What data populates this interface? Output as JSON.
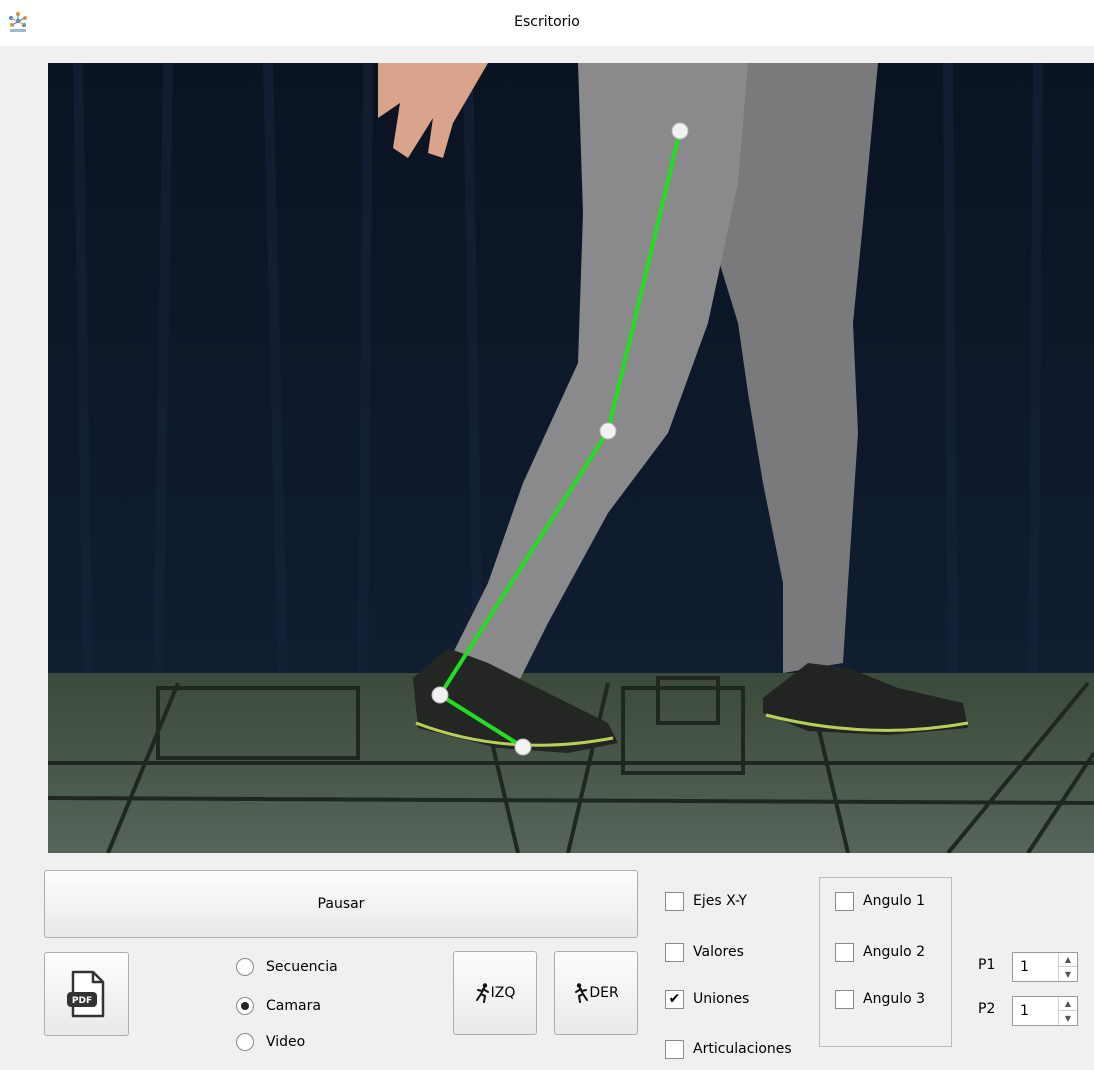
{
  "window": {
    "title": "Escritorio",
    "app_icon": "app-logo-icon"
  },
  "video": {
    "content": "camera-frame-legs",
    "tracking_line_color": "#22dd22",
    "marker_color": "#f2f2f2"
  },
  "controls": {
    "pause_label": "Pausar",
    "pdf_icon": "pdf-icon",
    "pdf_icon_text": "PDF",
    "izq_label": "IZQ",
    "der_label": "DER",
    "izq_icon": "runner-left-icon",
    "der_icon": "runner-right-icon"
  },
  "source": {
    "options": [
      {
        "label": "Secuencia",
        "selected": false
      },
      {
        "label": "Camara",
        "selected": true
      },
      {
        "label": "Video",
        "selected": false
      }
    ]
  },
  "display": {
    "options": [
      {
        "label": "Ejes X-Y",
        "checked": false
      },
      {
        "label": "Valores",
        "checked": false
      },
      {
        "label": "Uniones",
        "checked": true
      },
      {
        "label": "Articulaciones",
        "checked": false
      }
    ]
  },
  "angles": {
    "options": [
      {
        "label": "Angulo 1",
        "checked": false
      },
      {
        "label": "Angulo 2",
        "checked": false
      },
      {
        "label": "Angulo 3",
        "checked": false
      }
    ]
  },
  "points": {
    "p1_label": "P1",
    "p1_value": "1",
    "p2_label": "P2",
    "p2_value": "1"
  }
}
